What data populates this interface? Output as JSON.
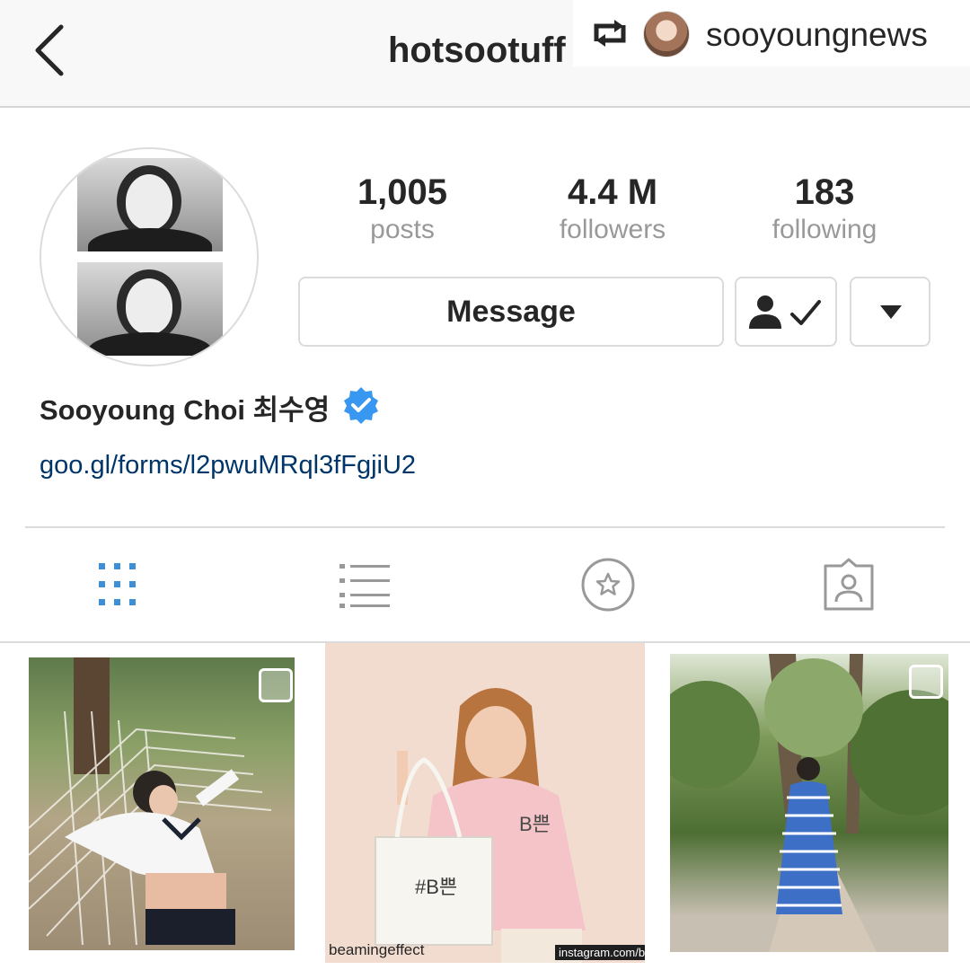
{
  "header": {
    "back_icon": "chevron-left-icon",
    "username": "hotsootuff"
  },
  "repost": {
    "icon": "repost-icon",
    "username": "sooyoungnews"
  },
  "profile": {
    "stats": [
      {
        "value": "1,005",
        "label": "posts"
      },
      {
        "value": "4.4 M",
        "label": "followers"
      },
      {
        "value": "183",
        "label": "following"
      }
    ],
    "message_label": "Message",
    "following_icon": "person-check-icon",
    "dropdown_icon": "caret-down-icon",
    "full_name": "Sooyoung Choi 최수영",
    "verified_icon": "verified-badge-icon",
    "verified_color": "#3897f0",
    "bio_link": "goo.gl/forms/l2pwuMRql3fFgjiU2"
  },
  "tabs": [
    {
      "name": "grid-view",
      "icon": "grid-icon",
      "active": true
    },
    {
      "name": "list-view",
      "icon": "list-icon",
      "active": false
    },
    {
      "name": "saved",
      "icon": "star-circle-icon",
      "active": false
    },
    {
      "name": "tagged",
      "icon": "tagged-person-icon",
      "active": false
    }
  ],
  "colors": {
    "active_tab": "#3f8fd6",
    "inactive_tab": "#999999",
    "link": "#003569",
    "border": "#dbdbdb"
  },
  "posts": [
    {
      "multi_icon": "multiple-photos-icon"
    },
    {
      "tote_text": "#B쁜",
      "shirt_text": "B쁜",
      "watermark_left": "beamingeffect",
      "watermark_right": "instagram.com/bea"
    },
    {
      "multi_icon": "multiple-photos-icon"
    }
  ]
}
